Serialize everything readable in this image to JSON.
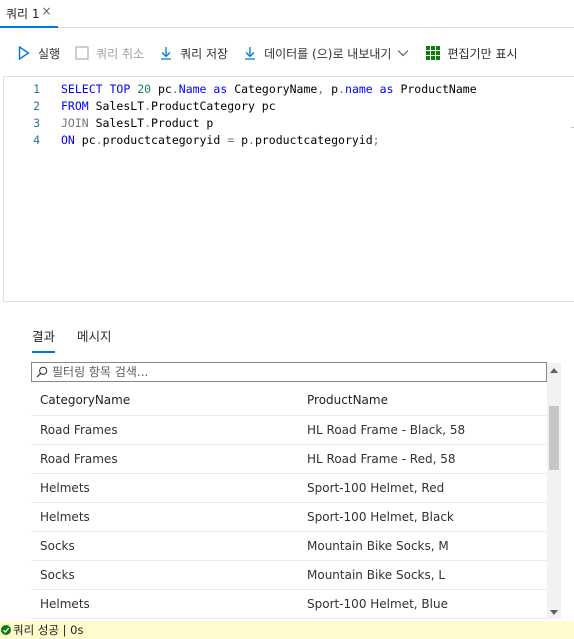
{
  "tab": {
    "label": "쿼리 1",
    "close": "×"
  },
  "toolbar": {
    "run": "실행",
    "cancel": "쿼리 취소",
    "save": "쿼리 저장",
    "export": "데이터를 (으)로 내보내기",
    "edit_only": "편집기만 표시"
  },
  "editor": {
    "lines": [
      {
        "num": "1",
        "parts": [
          {
            "t": "SELECT",
            "c": "kw"
          },
          {
            "t": " ",
            "c": "nm"
          },
          {
            "t": "TOP",
            "c": "kw"
          },
          {
            "t": " ",
            "c": "nm"
          },
          {
            "t": "20",
            "c": "num"
          },
          {
            "t": " pc",
            "c": "nm"
          },
          {
            "t": ".",
            "c": "op"
          },
          {
            "t": "Name",
            "c": "kw"
          },
          {
            "t": " ",
            "c": "nm"
          },
          {
            "t": "as",
            "c": "kw"
          },
          {
            "t": " CategoryName",
            "c": "nm"
          },
          {
            "t": ",",
            "c": "op"
          },
          {
            "t": " p",
            "c": "nm"
          },
          {
            "t": ".",
            "c": "op"
          },
          {
            "t": "name",
            "c": "kw"
          },
          {
            "t": " ",
            "c": "nm"
          },
          {
            "t": "as",
            "c": "kw"
          },
          {
            "t": " ProductName",
            "c": "nm"
          }
        ]
      },
      {
        "num": "2",
        "parts": [
          {
            "t": "FROM",
            "c": "kw"
          },
          {
            "t": " SalesLT",
            "c": "nm"
          },
          {
            "t": ".",
            "c": "op"
          },
          {
            "t": "ProductCategory pc",
            "c": "nm"
          }
        ]
      },
      {
        "num": "3",
        "parts": [
          {
            "t": "JOIN",
            "c": "gray"
          },
          {
            "t": " SalesLT",
            "c": "nm"
          },
          {
            "t": ".",
            "c": "op"
          },
          {
            "t": "Product p",
            "c": "nm"
          }
        ]
      },
      {
        "num": "4",
        "parts": [
          {
            "t": "ON",
            "c": "kw"
          },
          {
            "t": " pc",
            "c": "nm"
          },
          {
            "t": ".",
            "c": "op"
          },
          {
            "t": "productcategoryid ",
            "c": "nm"
          },
          {
            "t": "=",
            "c": "op"
          },
          {
            "t": " p",
            "c": "nm"
          },
          {
            "t": ".",
            "c": "op"
          },
          {
            "t": "productcategoryid",
            "c": "nm"
          },
          {
            "t": ";",
            "c": "op"
          }
        ]
      }
    ]
  },
  "results": {
    "tabs": [
      {
        "label": "결과",
        "active": true
      },
      {
        "label": "메시지",
        "active": false
      }
    ],
    "filter_placeholder": "필터링 항목 검색...",
    "columns": [
      "CategoryName",
      "ProductName"
    ],
    "rows": [
      [
        "Road Frames",
        "HL Road Frame - Black, 58"
      ],
      [
        "Road Frames",
        "HL Road Frame - Red, 58"
      ],
      [
        "Helmets",
        "Sport-100 Helmet, Red"
      ],
      [
        "Helmets",
        "Sport-100 Helmet, Black"
      ],
      [
        "Socks",
        "Mountain Bike Socks, M"
      ],
      [
        "Socks",
        "Mountain Bike Socks, L"
      ],
      [
        "Helmets",
        "Sport-100 Helmet, Blue"
      ]
    ]
  },
  "status": {
    "text": "쿼리 성공 | 0s"
  },
  "colors": {
    "accent": "#0078d4",
    "success": "#107c10",
    "status_bg": "#fffbcd",
    "keyword": "#0000ff"
  },
  "icons": [
    "play-icon",
    "stop-checkbox-icon",
    "download-icon",
    "export-icon",
    "chevron-down-icon",
    "grid-icon",
    "search-icon",
    "check-circle-icon"
  ]
}
